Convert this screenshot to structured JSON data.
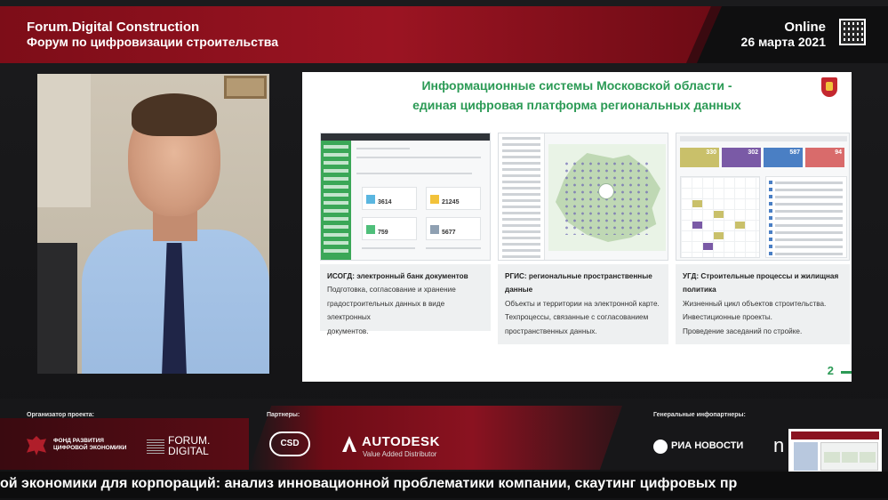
{
  "header": {
    "title": "Forum.Digital Construction",
    "subtitle": "Форум по цифровизации строительства",
    "mode": "Online",
    "date": "26 марта 2021"
  },
  "slide": {
    "title_line1": "Информационные системы Московской области -",
    "title_line2": "единая цифровая платформа региональных данных",
    "page_number": "2",
    "screens": {
      "isogd": {
        "card_values": [
          "3614",
          "21245",
          "759",
          "5677"
        ]
      },
      "ugd": {
        "tile_values": [
          "330",
          "302",
          "587",
          "94"
        ]
      }
    },
    "columns": [
      {
        "title": "ИСОГД: электронный банк документов",
        "lines": [
          "Подготовка, согласование и хранение",
          "градостроительных данных в виде электронных",
          "документов."
        ]
      },
      {
        "title": "РГИС: региональные пространственные данные",
        "lines": [
          "Объекты и территории на электронной карте.",
          "Техпроцессы, связанные с согласованием",
          "пространственных данных."
        ]
      },
      {
        "title": "УГД: Строительные процессы и жилищная политика",
        "lines": [
          "Жизненный цикл объектов строительства.",
          "Инвестиционные проекты.",
          "Проведение заседаний по стройке."
        ]
      }
    ]
  },
  "footer": {
    "organizer_label": "Организатор проекта:",
    "partners_label": "Партнеры:",
    "infopartners_label": "Генеральные инфопартнеры:",
    "fund_line1": "ФОНД РАЗВИТИЯ",
    "fund_line2": "ЦИФРОВОЙ ЭКОНОМИКИ",
    "forum_line1": "FORUM.",
    "forum_line2": "DIGITAL",
    "csd": "CSD",
    "autodesk": "AUTODESK",
    "autodesk_sub": "Value Added Distributor",
    "ria": "РИА НОВОСТИ",
    "partial_logo": "n"
  },
  "ticker": {
    "text": "ой экономики для корпораций: анализ инновационной проблематики компании, скаутинг цифровых пр"
  },
  "colors": {
    "brand_red": "#8a1220",
    "accent_green": "#2b9a55"
  }
}
